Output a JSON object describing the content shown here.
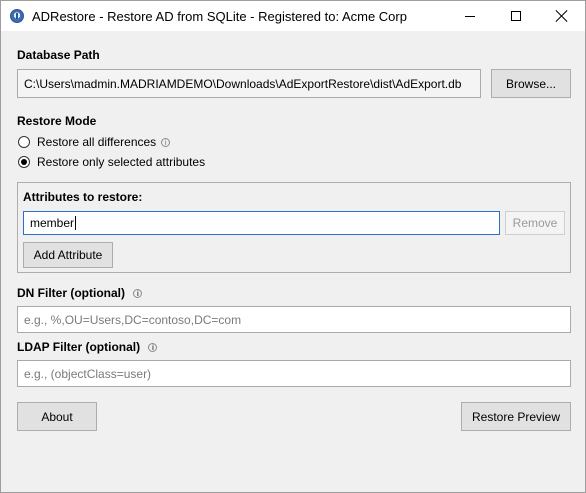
{
  "window": {
    "title": "ADRestore - Restore AD from SQLite - Registered to: Acme Corp",
    "icon": "app-icon"
  },
  "database": {
    "label": "Database Path",
    "path": "C:\\Users\\madmin.MADRIAMDEMO\\Downloads\\AdExportRestore\\dist\\AdExport.db",
    "browse_label": "Browse..."
  },
  "restore_mode": {
    "label": "Restore Mode",
    "options": [
      {
        "label": "Restore all differences",
        "checked": false,
        "info": "i"
      },
      {
        "label": "Restore only selected attributes",
        "checked": true
      }
    ]
  },
  "attributes": {
    "label": "Attributes to restore:",
    "value": "member",
    "remove_label": "Remove",
    "add_label": "Add Attribute"
  },
  "dn_filter": {
    "label": "DN Filter (optional)",
    "info": "i",
    "placeholder": "e.g., %,OU=Users,DC=contoso,DC=com"
  },
  "ldap_filter": {
    "label": "LDAP Filter (optional)",
    "info": "i",
    "placeholder": "e.g., (objectClass=user)"
  },
  "footer": {
    "about_label": "About",
    "preview_label": "Restore Preview"
  }
}
